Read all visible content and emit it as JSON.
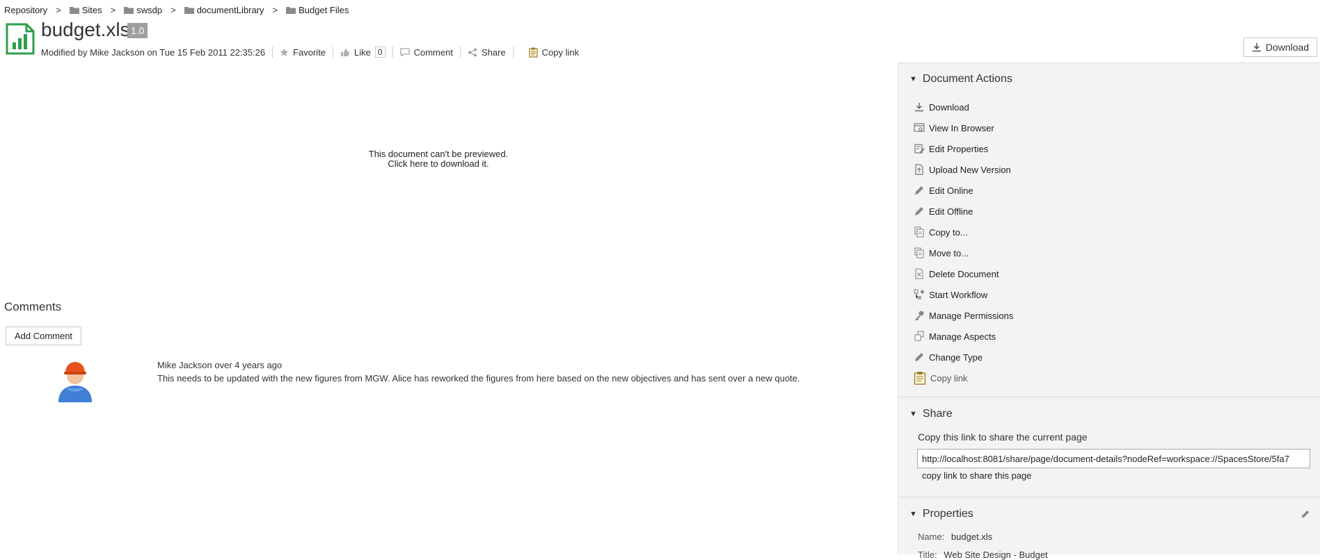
{
  "breadcrumb": [
    {
      "label": "Repository",
      "icon": "none"
    },
    {
      "label": "Sites",
      "icon": "folder-icon"
    },
    {
      "label": "swsdp",
      "icon": "folder-icon"
    },
    {
      "label": "documentLibrary",
      "icon": "folder-icon"
    },
    {
      "label": "Budget Files",
      "icon": "folder-icon"
    }
  ],
  "breadcrumb_separator": ">",
  "document": {
    "title": "budget.xls",
    "version": "1.0",
    "modified": "Modified by Mike Jackson on Tue 15 Feb 2011 22:35:26",
    "icon": "spreadsheet-file-icon"
  },
  "doc_actions": {
    "favorite": "Favorite",
    "like": "Like",
    "like_count": "0",
    "comment": "Comment",
    "share": "Share",
    "copy_link": "Copy link"
  },
  "download_button": "Download",
  "preview": {
    "line1": "This document can't be previewed.",
    "line2": "Click here to download it."
  },
  "comments": {
    "heading": "Comments",
    "add_button": "Add Comment",
    "items": [
      {
        "author": "Mike Jackson",
        "time": "over 4 years ago",
        "text": "This needs to be updated with the new figures from MGW. Alice has reworked the figures from here based on the new objectives and has sent over a new quote."
      }
    ]
  },
  "panel": {
    "document_actions_title": "Document Actions",
    "actions": [
      {
        "label": "Download",
        "icon": "download-icon"
      },
      {
        "label": "View In Browser",
        "icon": "view-in-browser-icon"
      },
      {
        "label": "Edit Properties",
        "icon": "edit-properties-icon"
      },
      {
        "label": "Upload New Version",
        "icon": "upload-icon"
      },
      {
        "label": "Edit Online",
        "icon": "pencil-icon"
      },
      {
        "label": "Edit Offline",
        "icon": "pencil-icon"
      },
      {
        "label": "Copy to...",
        "icon": "copy-icon"
      },
      {
        "label": "Move to...",
        "icon": "move-icon"
      },
      {
        "label": "Delete Document",
        "icon": "delete-icon"
      },
      {
        "label": "Start Workflow",
        "icon": "workflow-icon"
      },
      {
        "label": "Manage Permissions",
        "icon": "key-icon"
      },
      {
        "label": "Manage Aspects",
        "icon": "aspects-icon"
      },
      {
        "label": "Change Type",
        "icon": "pencil-icon"
      },
      {
        "label": "Copy link",
        "icon": "clipboard-icon"
      }
    ],
    "share_title": "Share",
    "share_label": "Copy this link to share the current page",
    "share_url": "http://localhost:8081/share/page/document-details?nodeRef=workspace://SpacesStore/5fa7",
    "share_note": "copy link to share this page",
    "properties_title": "Properties",
    "properties": [
      {
        "label": "Name:",
        "value": "budget.xls"
      },
      {
        "label": "Title:",
        "value": "Web Site Design - Budget"
      }
    ]
  },
  "colors": {
    "accent_green": "#2e9e4b",
    "panel_bg": "#f3f3f3",
    "badge_gray": "#9e9e9e"
  }
}
